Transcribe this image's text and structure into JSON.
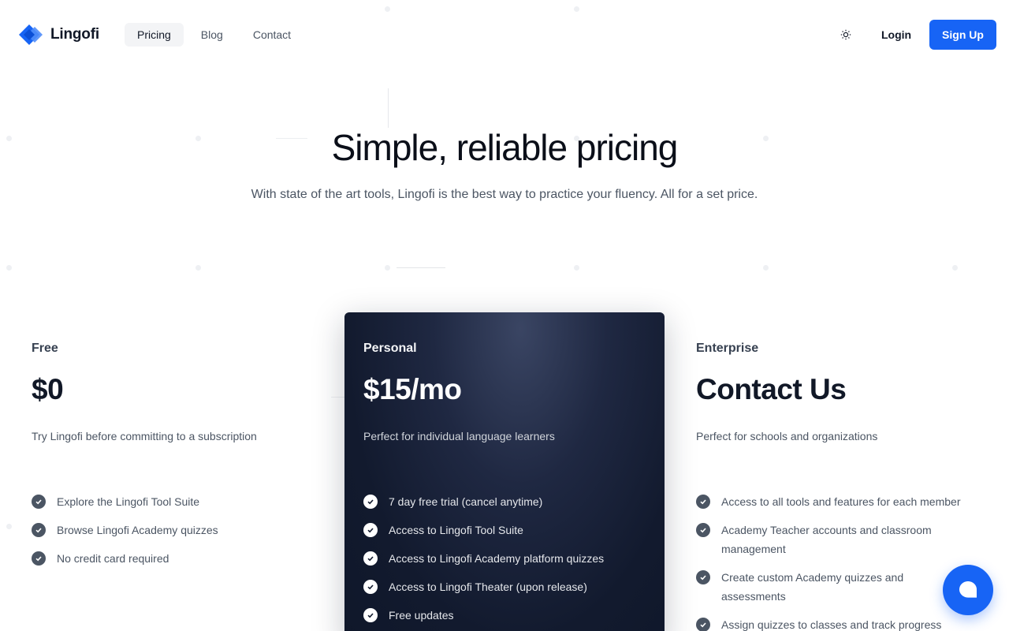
{
  "brand": {
    "name": "Lingofi",
    "accent": "#1764f5"
  },
  "nav": {
    "items": [
      {
        "label": "Pricing",
        "active": true
      },
      {
        "label": "Blog",
        "active": false
      },
      {
        "label": "Contact",
        "active": false
      }
    ],
    "theme_icon": "sun-icon",
    "login_label": "Login",
    "signup_label": "Sign Up"
  },
  "hero": {
    "title": "Simple, reliable pricing",
    "subtitle": "With state of the art tools, Lingofi is the best way to practice your fluency. All for a set price."
  },
  "plans": [
    {
      "name": "Free",
      "price": "$0",
      "description": "Try Lingofi before committing to a subscription",
      "features": [
        "Explore the Lingofi Tool Suite",
        "Browse Lingofi Academy quizzes",
        "No credit card required"
      ]
    },
    {
      "name": "Personal",
      "price": "$15/mo",
      "description": "Perfect for individual language learners",
      "features": [
        "7 day free trial (cancel anytime)",
        "Access to Lingofi Tool Suite",
        "Access to Lingofi Academy platform quizzes",
        "Access to Lingofi Theater (upon release)",
        "Free updates"
      ]
    },
    {
      "name": "Enterprise",
      "price": "Contact Us",
      "description": "Perfect for schools and organizations",
      "features": [
        "Access to all tools and features for each member",
        "Academy Teacher accounts and classroom management",
        "Create custom Academy quizzes and assessments",
        "Assign quizzes to classes and track progress"
      ]
    }
  ],
  "chat": {
    "icon": "chat-bubble-icon"
  }
}
